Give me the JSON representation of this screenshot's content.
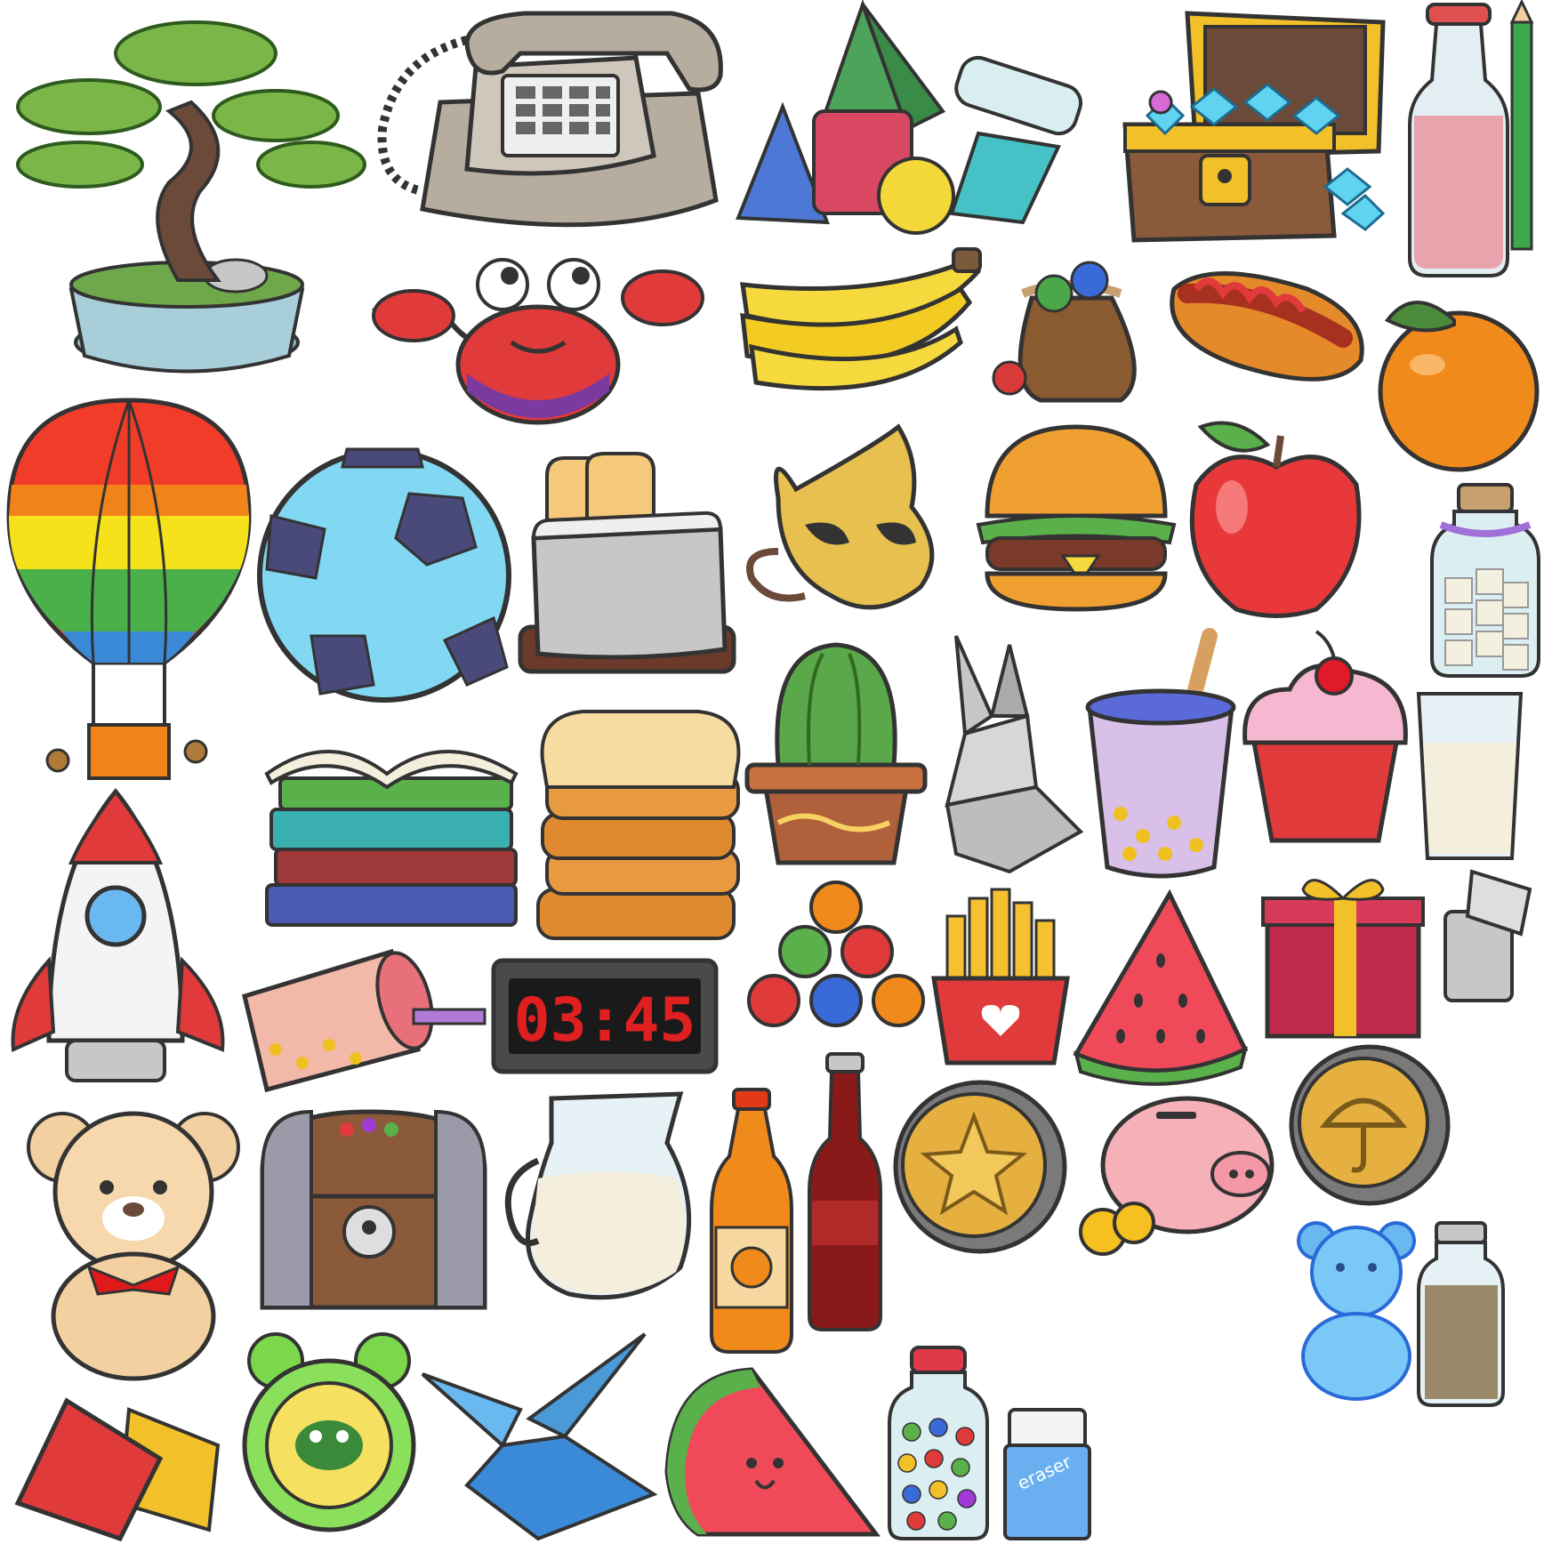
{
  "sprite_sheet": {
    "digital_clock": {
      "display": "03:45"
    },
    "eraser": {
      "label": "eraser"
    }
  }
}
